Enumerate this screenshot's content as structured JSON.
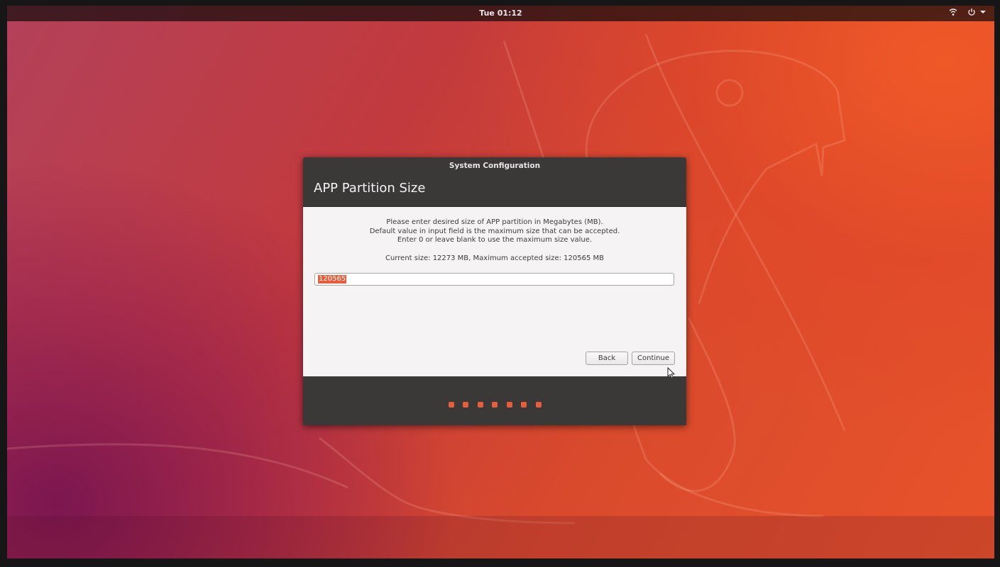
{
  "topbar": {
    "clock": "Tue 01:12",
    "icons": [
      "network-icon",
      "power-icon",
      "chevron-down-icon"
    ]
  },
  "dialog": {
    "window_title": "System Configuration",
    "heading": "APP Partition Size",
    "instructions": [
      "Please enter desired size of APP partition in Megabytes (MB).",
      "Default value in input field is the maximum size that can be accepted.",
      "Enter 0 or leave blank to use the maximum size value."
    ],
    "size_info": "Current size: 12273 MB, Maximum accepted size: 120565 MB",
    "input": {
      "value": "120565",
      "selected": true
    },
    "buttons": {
      "back": "Back",
      "continue": "Continue"
    },
    "progress": {
      "step_count": 7
    }
  },
  "colors": {
    "accent": "#e95d3b",
    "dialog_dark": "#3b3838",
    "dialog_body": "#f5f3f3"
  }
}
